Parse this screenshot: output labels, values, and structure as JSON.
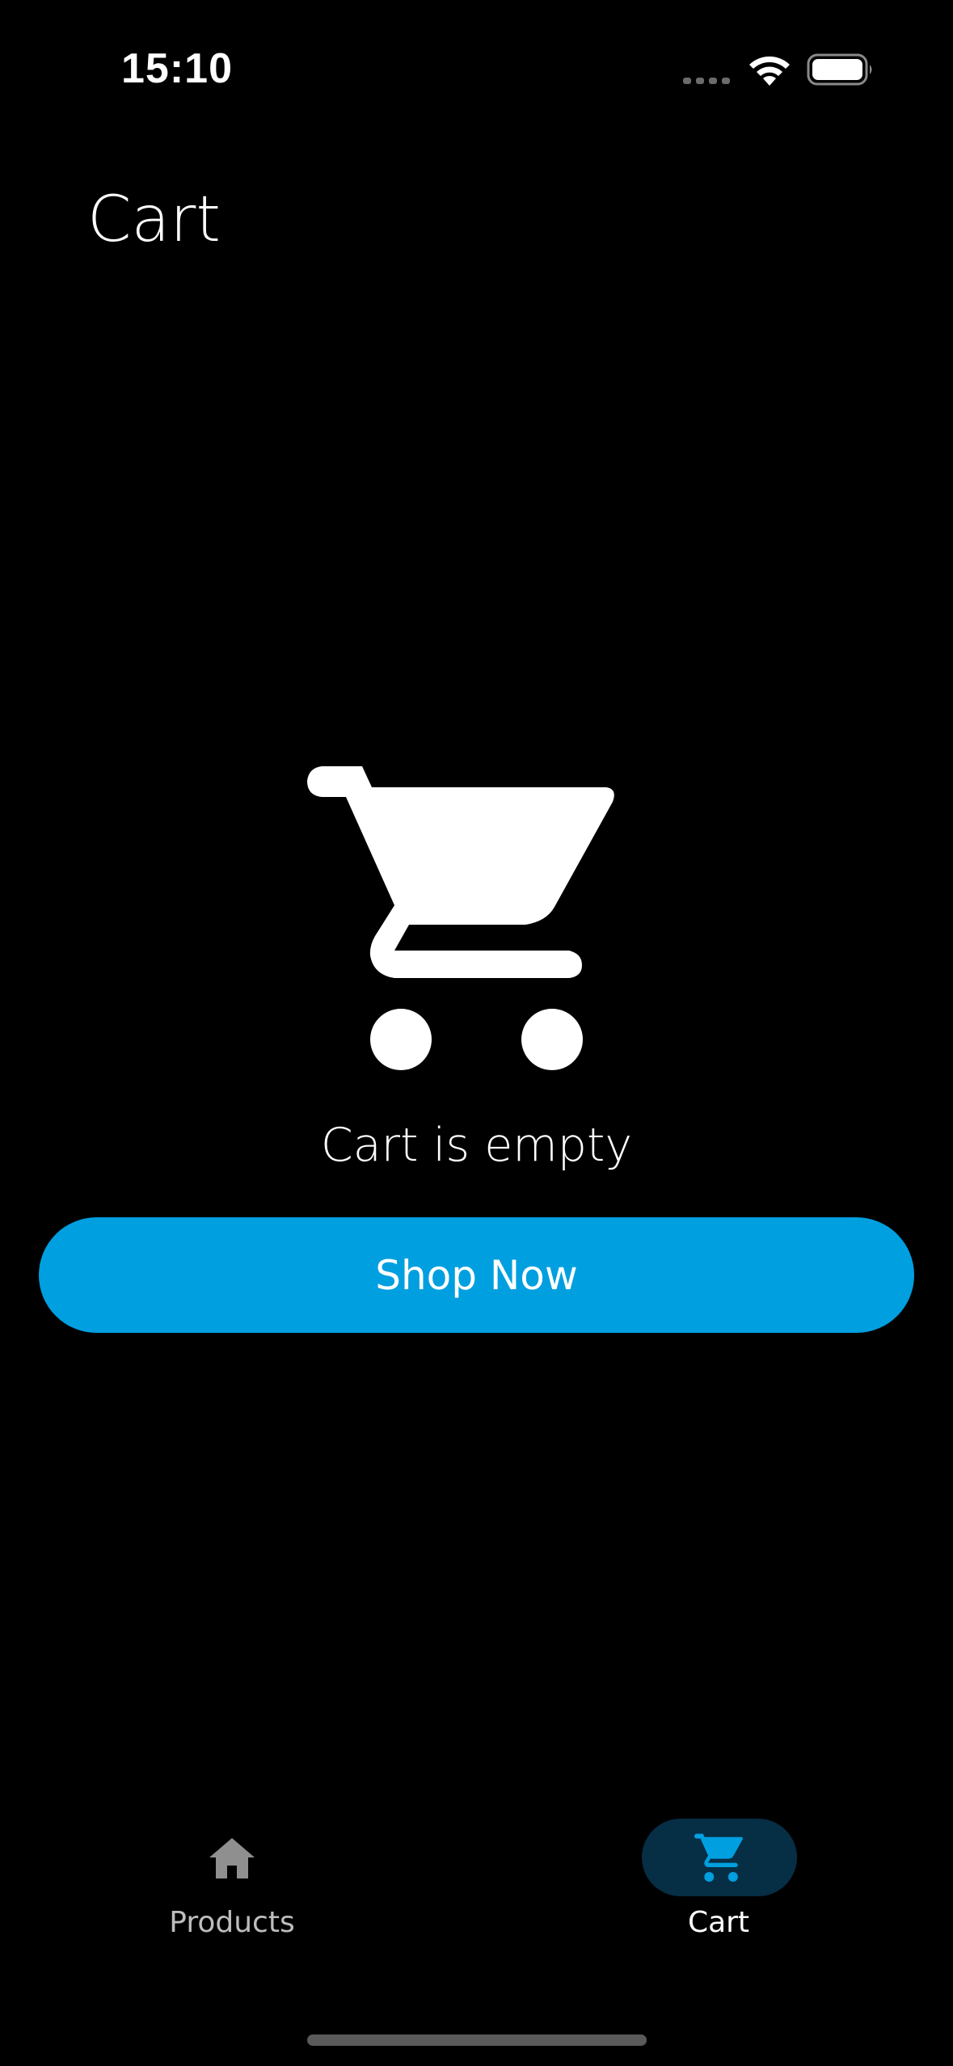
{
  "status_bar": {
    "time": "15:10",
    "signal_icon": "signal-dots-icon",
    "wifi_icon": "wifi-icon",
    "battery_icon": "battery-icon"
  },
  "header": {
    "title": "Cart"
  },
  "empty_state": {
    "icon": "shopping-cart-icon",
    "message": "Cart is empty",
    "button_label": "Shop Now"
  },
  "bottom_nav": {
    "items": [
      {
        "label": "Products",
        "icon": "home-icon",
        "selected": false
      },
      {
        "label": "Cart",
        "icon": "shopping-cart-icon",
        "selected": true
      }
    ]
  },
  "colors": {
    "background": "#000000",
    "accent": "#009FE0",
    "selected_pill": "#062E45",
    "inactive_nav": "#BDBDBD",
    "text": "#FFFFFF"
  }
}
